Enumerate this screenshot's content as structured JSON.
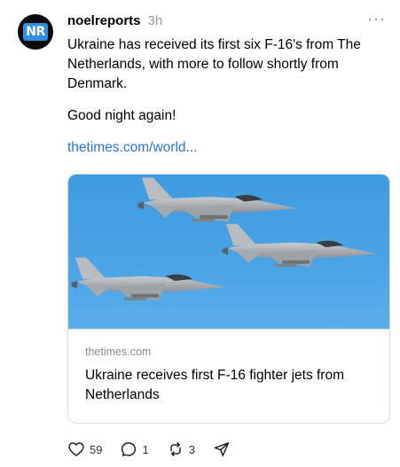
{
  "post": {
    "avatar_text": "NR",
    "username": "noelreports",
    "time": "3h",
    "more_label": "···",
    "text_1": "Ukraine has received its first six F-16's from The Netherlands, with more to follow shortly from Denmark.",
    "text_2": "Good night again!",
    "link": "thetimes.com/world..."
  },
  "card": {
    "domain": "thetimes.com",
    "title": "Ukraine receives first F-16 fighter jets from Netherlands"
  },
  "actions": {
    "likes": "59",
    "replies": "1",
    "reposts": "3"
  },
  "colors": {
    "link": "#2874d4",
    "sky": "#4aa3e5",
    "avatar_badge": "#2f8fe0"
  },
  "icons": [
    "more-icon",
    "heart-icon",
    "reply-icon",
    "repost-icon",
    "share-icon"
  ]
}
